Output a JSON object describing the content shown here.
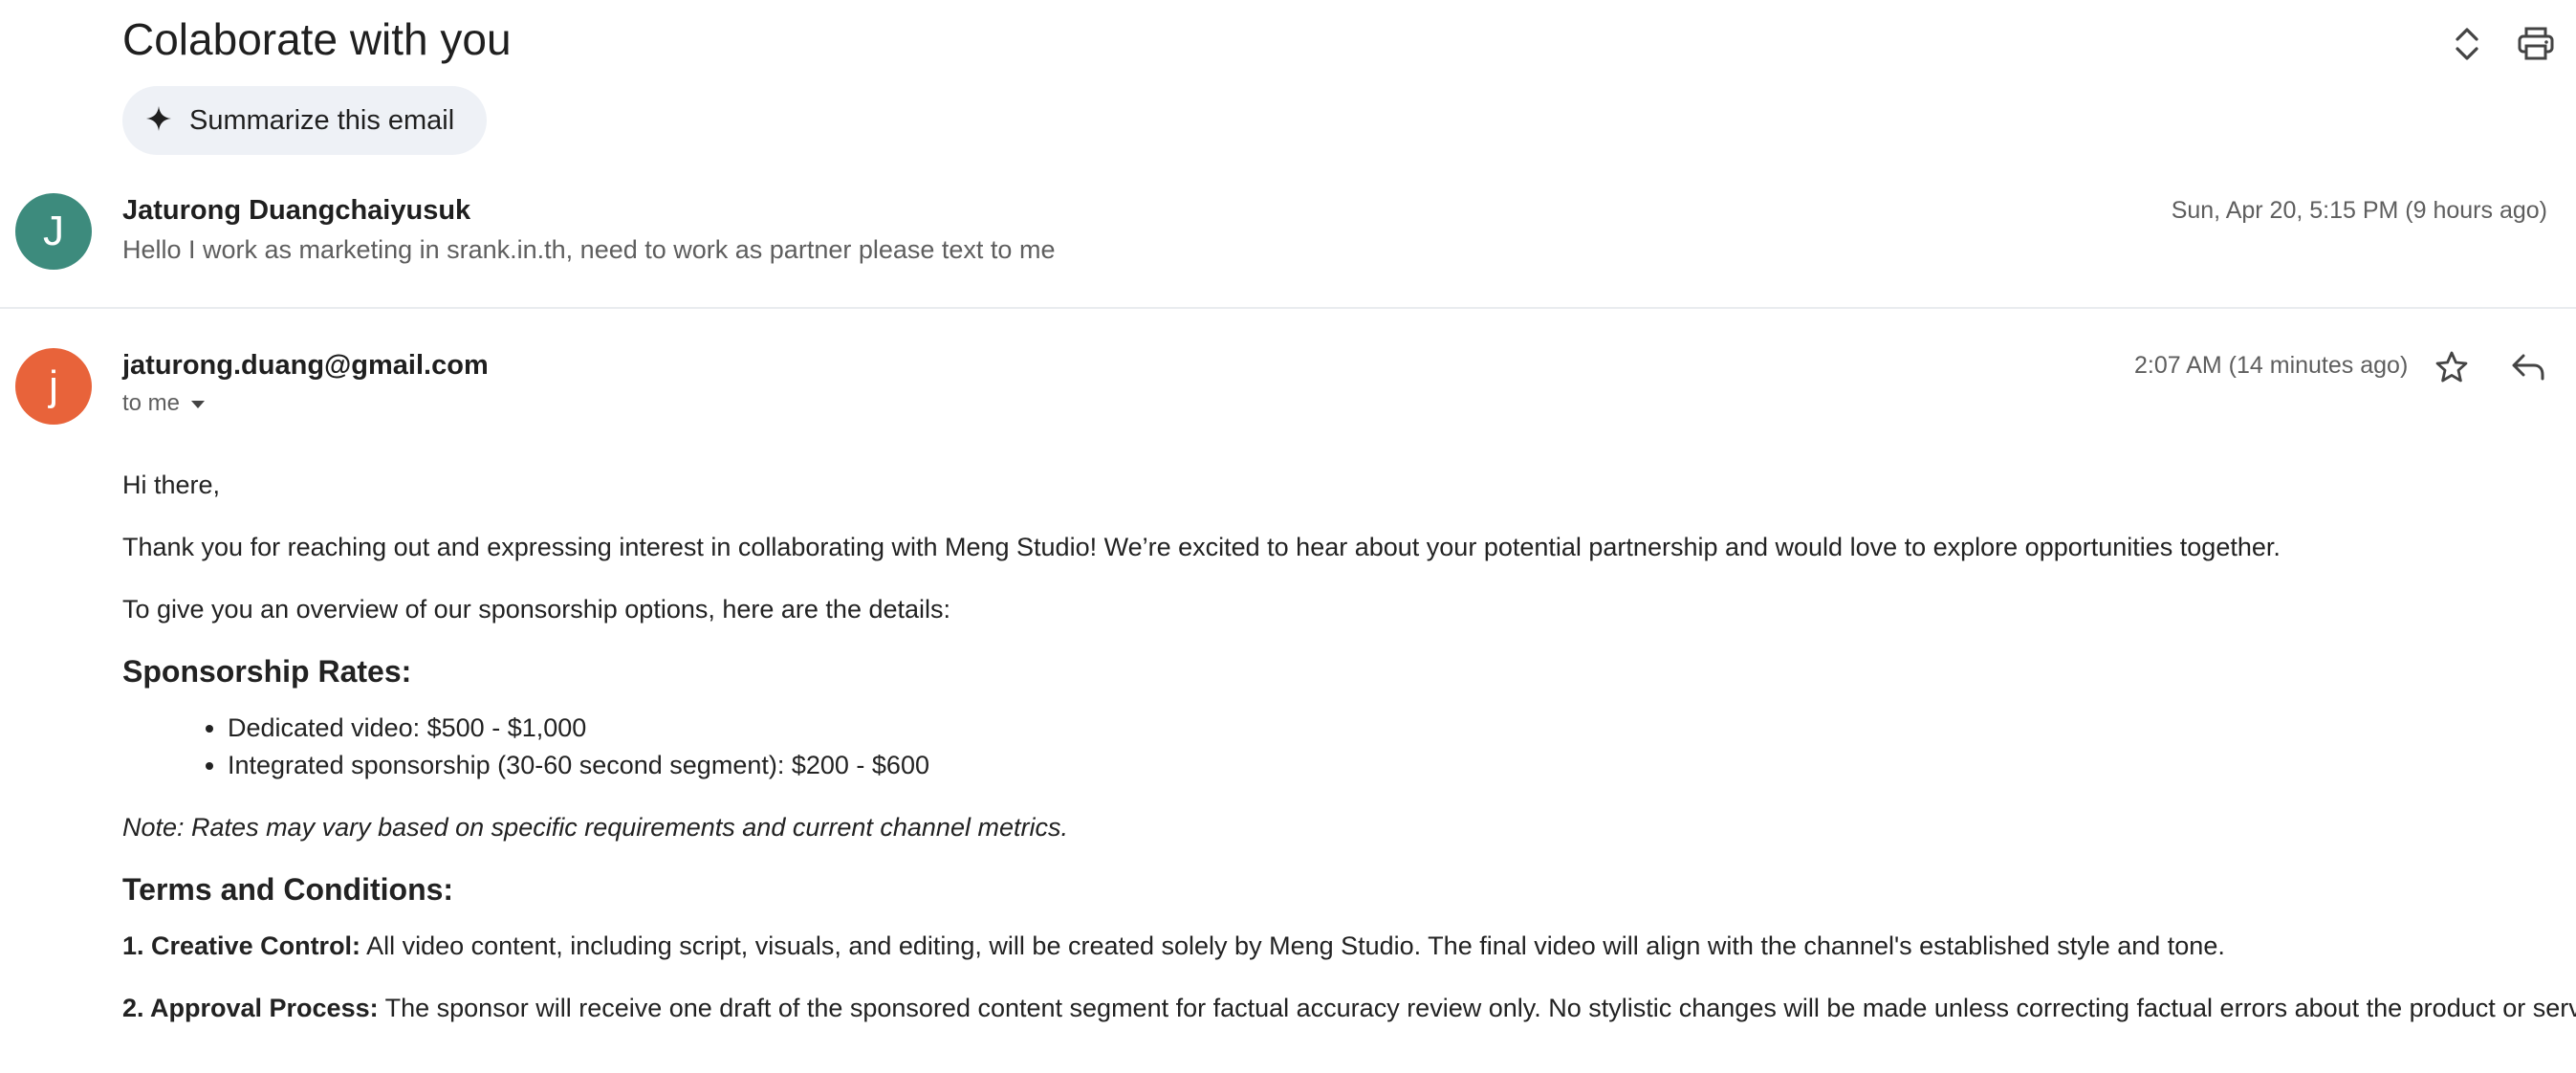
{
  "thread": {
    "subject": "Colaborate with you",
    "summarize_label": "Summarize this email",
    "icons": {
      "expand": "expand-collapse-icon",
      "print": "print-icon",
      "sparkle": "sparkle-icon"
    }
  },
  "messages": [
    {
      "avatar_letter": "J",
      "avatar_color": "#3d8b7d",
      "sender": "Jaturong Duangchaiyusuk",
      "snippet": "Hello I work as marketing in srank.in.th, need to work as partner please text to me",
      "date": "Sun, Apr 20, 5:15 PM (9 hours ago)"
    },
    {
      "avatar_letter": "j",
      "avatar_color": "#e8633a",
      "sender": "jaturong.duang@gmail.com",
      "recipient": "to me",
      "date": "2:07 AM (14 minutes ago)"
    }
  ],
  "email_body": {
    "greeting": "Hi there,",
    "intro": "Thank you for reaching out and expressing interest in collaborating with Meng Studio! We’re excited to hear about your potential partnership and would love to explore opportunities together.",
    "overview": "To give you an overview of our sponsorship options, here are the details:",
    "rates_heading": "Sponsorship Rates:",
    "rates": [
      "Dedicated video: $500 - $1,000",
      "Integrated sponsorship (30-60 second segment): $200 - $600"
    ],
    "note": "Note: Rates may vary based on specific requirements and current channel metrics.",
    "terms_heading": "Terms and Conditions:",
    "terms": [
      {
        "title": "1. Creative Control:",
        "text": " All video content, including script, visuals, and editing, will be created solely by Meng Studio. The final video will align with the channel's established style and tone."
      },
      {
        "title": "2. Approval Process:",
        "text": " The sponsor will receive one draft of the sponsored content segment for factual accuracy review only. No stylistic changes will be made unless correcting factual errors about the product or service."
      }
    ]
  }
}
